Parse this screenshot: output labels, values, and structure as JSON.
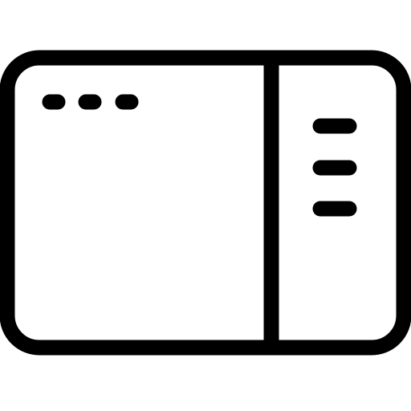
{
  "icon": {
    "name": "window-with-sidebar-icon",
    "stroke_color": "#000000",
    "background_color": "#ffffff",
    "titlebar_dots": 3,
    "sidebar_lines": 3
  }
}
